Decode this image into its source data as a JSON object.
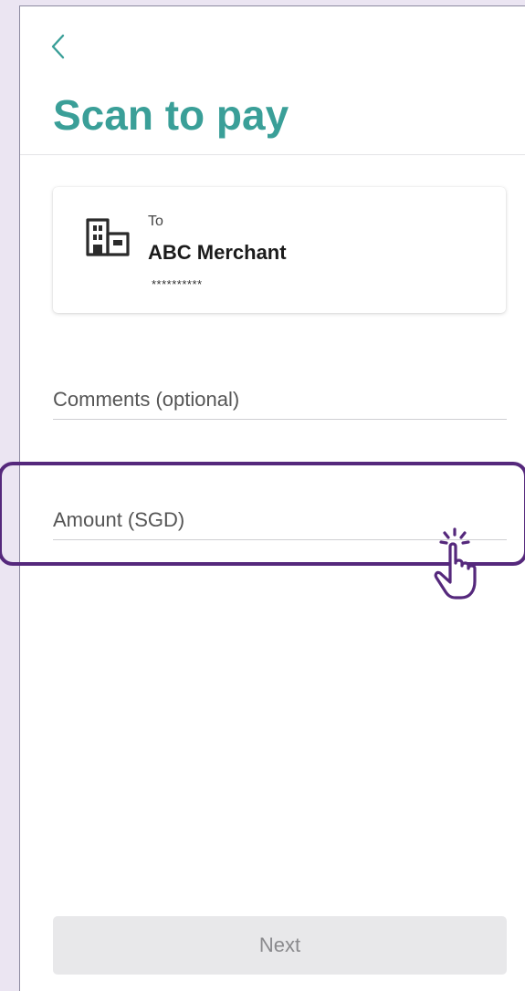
{
  "theme": {
    "accent": "#3a9f98",
    "highlight": "#55287c",
    "button_disabled_bg": "#e8e8ea",
    "button_disabled_text": "#8a8a8d"
  },
  "header": {
    "back_icon": "chevron-left-icon",
    "title": "Scan to pay"
  },
  "recipient": {
    "icon": "building-icon",
    "to_label": "To",
    "name": "ABC Merchant",
    "account_masked": "**********"
  },
  "form": {
    "comments_placeholder": "Comments (optional)",
    "amount_placeholder": "Amount (SGD)"
  },
  "overlay": {
    "tap_icon": "tap-hand-icon"
  },
  "footer": {
    "next_label": "Next",
    "next_state": "disabled"
  }
}
